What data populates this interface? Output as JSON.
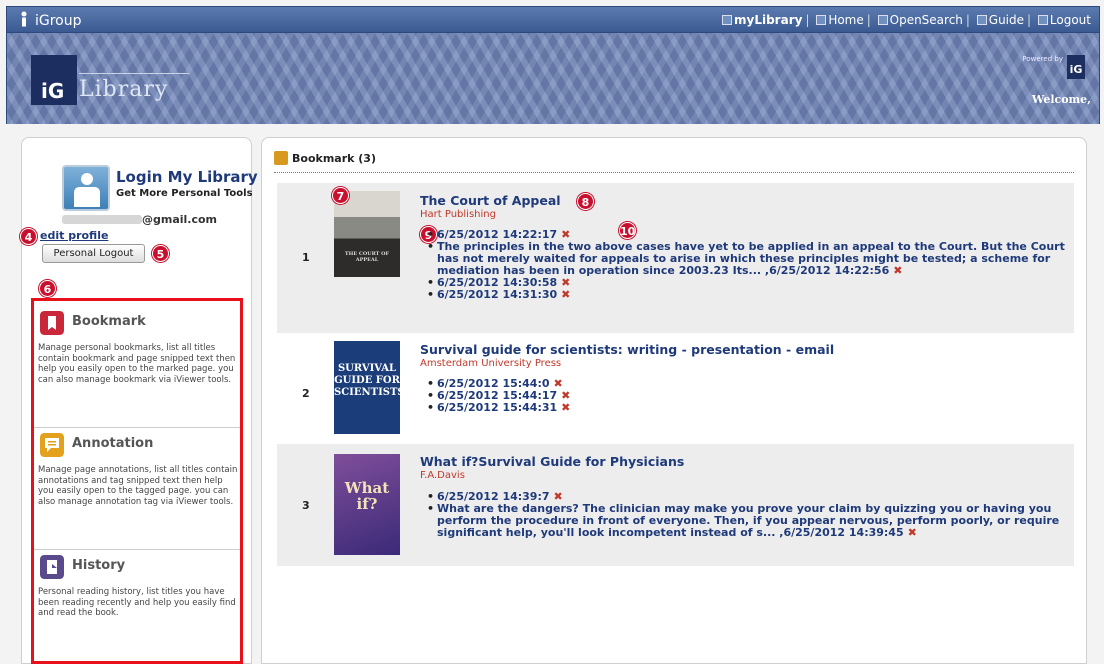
{
  "topbar": {
    "brand": "iGroup",
    "links": [
      {
        "label": "myLibrary",
        "strong": true
      },
      {
        "label": "Home"
      },
      {
        "label": "OpenSearch"
      },
      {
        "label": "Guide"
      },
      {
        "label": "Logout"
      }
    ]
  },
  "banner": {
    "logo_ig": "iG",
    "logo_library": "Library",
    "powered_by": "Powered by",
    "powered_logo": "iG",
    "welcome": "Welcome,"
  },
  "profile": {
    "title": "Login My Library",
    "subtitle": "Get More Personal Tools",
    "email_suffix": "@gmail.com",
    "edit_profile": "edit profile",
    "logout_button": "Personal Logout"
  },
  "tools": [
    {
      "name": "Bookmark",
      "icon": "bookmark-icon",
      "color": "#c8283a",
      "desc": "Manage personal bookmarks, list all titles contain bookmark and page snipped text then help you easily open to the marked page. you can also manage bookmark via iViewer tools."
    },
    {
      "name": "Annotation",
      "icon": "annotation-icon",
      "color": "#e3a11e",
      "desc": "Manage page annotations, list all titles contain annotations and tag snipped text then help you easily open to the tagged page. you can also manage annotation tag via iViewer tools."
    },
    {
      "name": "History",
      "icon": "history-icon",
      "color": "#5a4a8c",
      "desc": "Personal reading history, list titles you have been reading recently and help you easily find and read the book."
    }
  ],
  "callouts": [
    "4",
    "5",
    "6",
    "7",
    "8",
    "9",
    "10"
  ],
  "bookmarks_header": "Bookmark (3)",
  "books": [
    {
      "num": "1",
      "title": "The Court of Appeal",
      "publisher": "Hart Publishing",
      "cover_text": "THE COURT OF APPEAL",
      "entries": [
        {
          "text": "6/25/2012 14:22:17"
        },
        {
          "text": "The principles in the two above cases have yet to be applied in an appeal to the Court. But the Court has not merely waited for appeals to arise in which these principles might be tested; a scheme for mediation has been in operation since 2003.23 Its... ,6/25/2012 14:22:56"
        },
        {
          "text": "6/25/2012 14:30:58"
        },
        {
          "text": "6/25/2012 14:31:30"
        }
      ]
    },
    {
      "num": "2",
      "title": "Survival guide for scientists: writing - presentation - email",
      "publisher": "Amsterdam University Press",
      "cover_text": "SURVIVAL GUIDE FOR SCIENTISTS",
      "entries": [
        {
          "text": "6/25/2012 15:44:0"
        },
        {
          "text": "6/25/2012 15:44:17"
        },
        {
          "text": "6/25/2012 15:44:31"
        }
      ]
    },
    {
      "num": "3",
      "title": "What if?Survival Guide for Physicians",
      "publisher": "F.A.Davis",
      "cover_text": "What if?",
      "entries": [
        {
          "text": "6/25/2012 14:39:7"
        },
        {
          "text": "What are the dangers? The clinician may make you prove your claim by quizzing you or having you perform the procedure in front of everyone. Then, if you appear nervous, perform poorly, or require significant help, you'll look incompetent instead of s... ,6/25/2012 14:39:45"
        }
      ]
    }
  ],
  "delete_glyph": "✖"
}
